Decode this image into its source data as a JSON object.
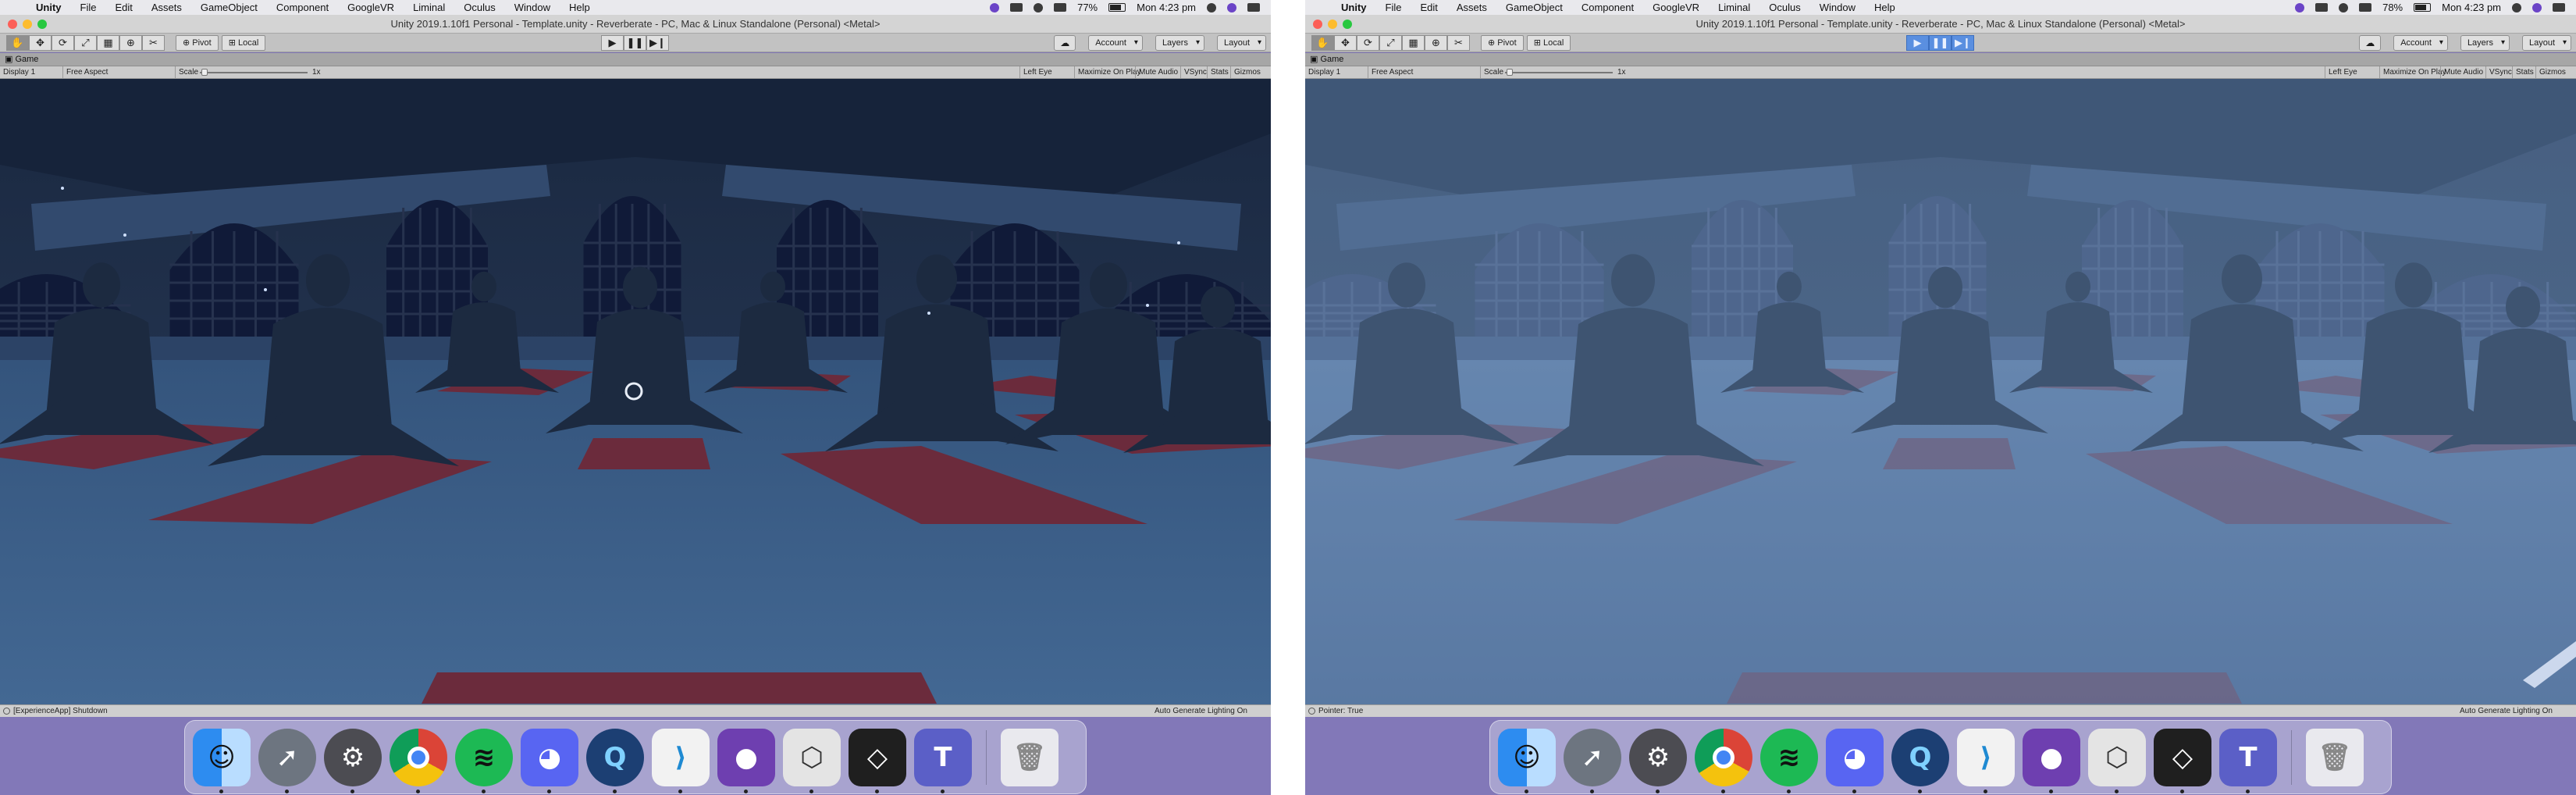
{
  "screens": [
    {
      "menubar": {
        "app_name": "Unity",
        "menus": [
          "File",
          "Edit",
          "Assets",
          "GameObject",
          "Component",
          "GoogleVR",
          "Liminal",
          "Oculus",
          "Window",
          "Help"
        ],
        "battery": "77%",
        "clock": "Mon 4:23 pm"
      },
      "window_title": "Unity 2019.1.10f1 Personal - Template.unity - Reverberate - PC, Mac & Linux Standalone (Personal) <Metal>",
      "toolbar": {
        "pivot": "Pivot",
        "local": "Local",
        "account": "Account",
        "layers": "Layers",
        "layout": "Layout"
      },
      "play_state": "stopped",
      "game_tab": "Game",
      "game_bar": {
        "display": "Display 1",
        "aspect": "Free Aspect",
        "scale_label": "Scale",
        "scale_value": "1x",
        "eye": "Left Eye",
        "maximize": "Maximize On Play",
        "mute": "Mute Audio",
        "vsync": "VSync",
        "stats": "Stats",
        "gizmos": "Gizmos"
      },
      "status": {
        "message": "[ExperienceApp] Shutdown",
        "right": "Auto Generate Lighting On"
      }
    },
    {
      "menubar": {
        "app_name": "Unity",
        "menus": [
          "File",
          "Edit",
          "Assets",
          "GameObject",
          "Component",
          "GoogleVR",
          "Liminal",
          "Oculus",
          "Window",
          "Help"
        ],
        "battery": "78%",
        "clock": "Mon 4:23 pm"
      },
      "window_title": "Unity 2019.1.10f1 Personal - Template.unity - Reverberate - PC, Mac & Linux Standalone (Personal) <Metal>",
      "toolbar": {
        "pivot": "Pivot",
        "local": "Local",
        "account": "Account",
        "layers": "Layers",
        "layout": "Layout"
      },
      "play_state": "playing",
      "game_tab": "Game",
      "game_bar": {
        "display": "Display 1",
        "aspect": "Free Aspect",
        "scale_label": "Scale",
        "scale_value": "1x",
        "eye": "Left Eye",
        "maximize": "Maximize On Play",
        "mute": "Mute Audio",
        "vsync": "VSync",
        "stats": "Stats",
        "gizmos": "Gizmos"
      },
      "status": {
        "message": "Pointer: True",
        "right": "Auto Generate Lighting On"
      }
    }
  ],
  "dock_apps": [
    {
      "name": "Finder",
      "icon": "finder-icon",
      "glyph": "☺"
    },
    {
      "name": "Launchpad",
      "icon": "rocket-icon",
      "glyph": "➚"
    },
    {
      "name": "System Preferences",
      "icon": "gear-icon",
      "glyph": "⚙"
    },
    {
      "name": "Google Chrome",
      "icon": "chrome-icon",
      "glyph": ""
    },
    {
      "name": "Spotify",
      "icon": "spotify-icon",
      "glyph": "≋"
    },
    {
      "name": "Discord",
      "icon": "discord-icon",
      "glyph": "◕"
    },
    {
      "name": "QuickTime Player",
      "icon": "quicktime-icon",
      "glyph": "Q"
    },
    {
      "name": "Visual Studio Code",
      "icon": "vscode-icon",
      "glyph": "⟩"
    },
    {
      "name": "GitHub Desktop",
      "icon": "github-icon",
      "glyph": "●"
    },
    {
      "name": "Unity Hub",
      "icon": "unity-hub-icon",
      "glyph": "⬡"
    },
    {
      "name": "Unity",
      "icon": "unity-icon",
      "glyph": "◇"
    },
    {
      "name": "Microsoft Teams",
      "icon": "teams-icon",
      "glyph": "T"
    },
    {
      "name": "Trash",
      "icon": "trash-icon",
      "glyph": "🗑"
    }
  ],
  "colors": {
    "desktop": "#8278b8",
    "scene_sky": "#1c2b44",
    "scene_floor": "#3d5e86",
    "yoga_mat": "#6b2b3c",
    "fog": "#7d9ac0",
    "play_active": "#5a8fe0"
  }
}
